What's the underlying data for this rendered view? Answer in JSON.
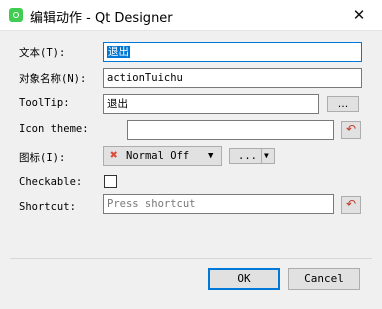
{
  "window": {
    "title": "编辑动作 - Qt Designer",
    "close_glyph": "✕",
    "app_icon": "qt-designer-icon"
  },
  "form": {
    "text_label": "文本(T):",
    "text_value": "退出",
    "object_name_label": "对象名称(N):",
    "object_name_value": "actionTuichu",
    "tooltip_label": "ToolTip:",
    "tooltip_value": "退出",
    "tooltip_more": "...",
    "icon_theme_label": "Icon theme:",
    "icon_theme_value": "",
    "icon_label": "图标(I):",
    "icon_mode": "Normal Off",
    "icon_more": "...",
    "checkable_label": "Checkable:",
    "checkable_checked": false,
    "shortcut_label": "Shortcut:",
    "shortcut_placeholder": "Press shortcut",
    "reset_glyph": "↶"
  },
  "buttons": {
    "ok": "OK",
    "cancel": "Cancel"
  },
  "colors": {
    "focus": "#0078d7",
    "reset_icon": "#c0392b",
    "mode_icon": "#e04a3a"
  }
}
